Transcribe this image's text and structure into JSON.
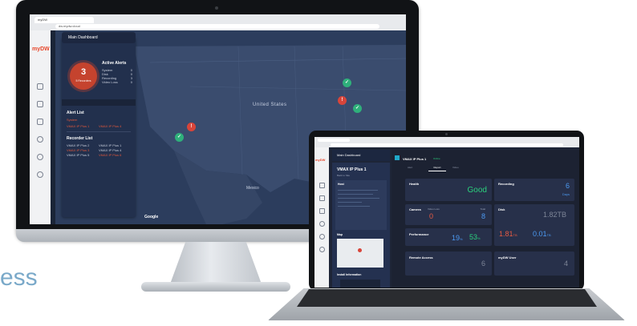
{
  "tagline": "ess",
  "monitor": {
    "browser": {
      "tab_label": "myDW",
      "url": "dw.mydw.cloud"
    },
    "app": {
      "logo": "myDW",
      "header_title": "Main Dashboard",
      "alert_count": "3",
      "alert_count_label": "Alert",
      "recorders_count_label": "5 Recorders",
      "active_alerts_title": "Active Alerts",
      "active_alerts": [
        {
          "label": "System",
          "value": "0"
        },
        {
          "label": "Disk",
          "value": "0"
        },
        {
          "label": "Recording",
          "value": "3"
        },
        {
          "label": "Video Loss",
          "value": "0"
        }
      ],
      "alert_list_title": "Alert List",
      "alert_list_subtitle": "System",
      "alert_list_items": [
        "VMAX IP Plus 1",
        "VMAX IP Plus 4"
      ],
      "recorder_list_title": "Recorder List",
      "recorders": [
        "VMAX IP Plus 2",
        "VMAX IP Plus 1",
        "VMAX IP Plus 3",
        "VMAX IP Plus 4",
        "VMAX IP Plus 5",
        "VMAX IP Plus 6"
      ]
    },
    "map": {
      "country_label": "United States",
      "mexico_label": "Mexico",
      "attribution": "Google",
      "pins": [
        {
          "status": "up",
          "color": "#2fb07b"
        },
        {
          "status": "alert",
          "color": "#d8453a"
        },
        {
          "status": "up",
          "color": "#2fb07b"
        },
        {
          "status": "alert",
          "color": "#d8453a"
        },
        {
          "status": "up",
          "color": "#2fb07b"
        }
      ]
    }
  },
  "laptop": {
    "app": {
      "logo": "myDW",
      "header_title": "Main Dashboard",
      "device_title": "VMAX IP Plus 1",
      "device_status": "Online",
      "device_sub": "Back to Site",
      "tabs": [
        "Alert",
        "Report",
        "Video"
      ],
      "detail_heading": "Host",
      "map_heading": "Map",
      "install_info_heading": "Install Information",
      "cards": {
        "health": {
          "title": "Health",
          "value": "Good"
        },
        "recording": {
          "title": "Recording",
          "sub": "Days",
          "value": "6"
        },
        "camera": {
          "title": "Camera",
          "offline_label": "Video Loss",
          "offline_value": "0",
          "total_label": "Total",
          "total_value": "8"
        },
        "disk": {
          "title": "Disk",
          "value": "1.82TB",
          "used_value": "1.81",
          "used_unit": "TB",
          "free_value": "0.01",
          "free_unit": "TB"
        },
        "performance": {
          "title": "Performance",
          "cpu": "19",
          "cpu_unit": "%",
          "mem": "53",
          "mem_unit": "%"
        },
        "remote": {
          "title": "Remote Access",
          "value": "6"
        },
        "users": {
          "title": "myDW User",
          "value": "4"
        }
      }
    }
  },
  "colors": {
    "brand": "#e8462a",
    "panel": "#22304d",
    "map_bg": "#2c3d5d",
    "good": "#2bd07d",
    "info": "#4c9af2",
    "alert": "#e75a42"
  }
}
